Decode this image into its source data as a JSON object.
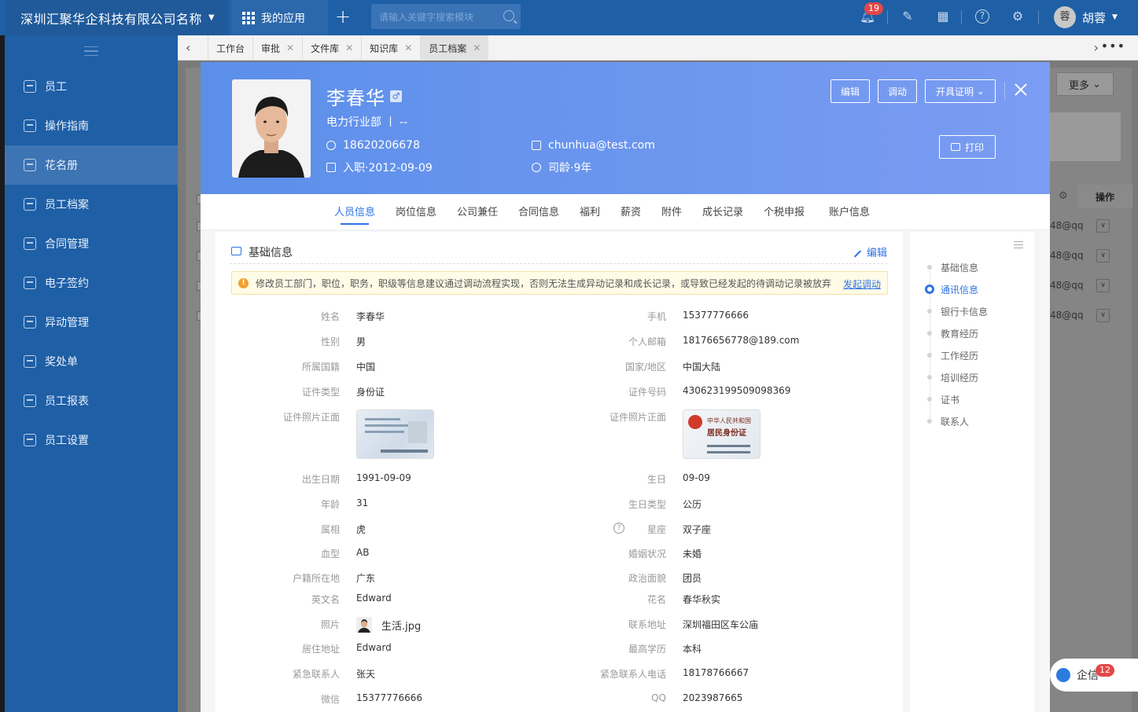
{
  "topbar": {
    "company": "深圳汇聚华企科技有限公司名称",
    "my_apps": "我的应用",
    "search_placeholder": "请输入关键字搜索模块",
    "notif_count": "19",
    "user_avatar": "蓉",
    "user_name": "胡蓉"
  },
  "sidebar": {
    "items": [
      {
        "label": "员工"
      },
      {
        "label": "操作指南"
      },
      {
        "label": "花名册"
      },
      {
        "label": "员工档案"
      },
      {
        "label": "合同管理"
      },
      {
        "label": "电子签约"
      },
      {
        "label": "异动管理"
      },
      {
        "label": "奖处单"
      },
      {
        "label": "员工报表"
      },
      {
        "label": "员工设置"
      }
    ],
    "active_index": 2
  },
  "tabs": [
    {
      "label": "工作台",
      "closable": false
    },
    {
      "label": "审批",
      "closable": true
    },
    {
      "label": "文件库",
      "closable": true
    },
    {
      "label": "知识库",
      "closable": true
    },
    {
      "label": "员工档案",
      "closable": true,
      "active": true
    }
  ],
  "background": {
    "more_label": "更多",
    "op_header": "操作",
    "email_fragment": "48@qq"
  },
  "qixin": {
    "label": "企信",
    "count": "12"
  },
  "profile": {
    "name": "李春华",
    "gender_symbol": "♂",
    "dept": "电力行业部 丨 --",
    "phone": "18620206678",
    "email": "chunhua@test.com",
    "join": "入职·2012-09-09",
    "seniority": "司龄·9年",
    "btn_edit": "编辑",
    "btn_transfer": "调动",
    "btn_cert": "开具证明",
    "btn_print": "打印"
  },
  "mtabs": [
    {
      "label": "人员信息",
      "active": true
    },
    {
      "label": "岗位信息"
    },
    {
      "label": "公司兼任"
    },
    {
      "label": "合同信息"
    },
    {
      "label": "福利"
    },
    {
      "label": "薪资"
    },
    {
      "label": "附件"
    },
    {
      "label": "成长记录"
    },
    {
      "label": "个税申报"
    },
    {
      "label": "账户信息"
    }
  ],
  "basic": {
    "title": "基础信息",
    "edit": "编辑",
    "warning": "修改员工部门，职位，职务，职级等信息建议通过调动流程实现，否则无法生成异动记录和成长记录，或导致已经发起的待调动记录被放弃",
    "warning_link": "发起调动"
  },
  "fields": {
    "name_l": "姓名",
    "name_v": "李春华",
    "mobile_l": "手机",
    "mobile_v": "15377776666",
    "sex_l": "性别",
    "sex_v": "男",
    "pemail_l": "个人邮箱",
    "pemail_v": "18176656778@189.com",
    "nat_l": "所属国籍",
    "nat_v": "中国",
    "region_l": "国家/地区",
    "region_v": "中国大陆",
    "idtype_l": "证件类型",
    "idtype_v": "身份证",
    "idno_l": "证件号码",
    "idno_v": "430623199509098369",
    "idfront_l": "证件照片正面",
    "idback_l": "证件照片正面",
    "idcard_back_title": "中华人民共和国",
    "idcard_back_title2": "居民身份证",
    "birth_l": "出生日期",
    "birth_v": "1991-09-09",
    "bday_l": "生日",
    "bday_v": "09-09",
    "age_l": "年龄",
    "age_v": "31",
    "bdtype_l": "生日类型",
    "bdtype_v": "公历",
    "zodiac_l": "属相",
    "zodiac_v": "虎",
    "star_l": "星座",
    "star_v": "双子座",
    "blood_l": "血型",
    "blood_v": "AB",
    "marital_l": "婚姻状况",
    "marital_v": "未婚",
    "huji_l": "户籍所在地",
    "huji_v": "广东",
    "political_l": "政治面貌",
    "political_v": "团员",
    "en_l": "英文名",
    "en_v": "Edward",
    "nick_l": "花名",
    "nick_v": "春华秋实",
    "photo_l": "照片",
    "photo_v": "生活.jpg",
    "addr_l": "联系地址",
    "addr_v": "深圳福田区车公庙",
    "live_l": "居住地址",
    "live_v": "Edward",
    "edu_l": "最高学历",
    "edu_v": "本科",
    "em_l": "紧急联系人",
    "em_v": "张天",
    "emtel_l": "紧急联系人电话",
    "emtel_v": "18178766667",
    "wx_l": "微信",
    "wx_v": "15377776666",
    "qq_l": "QQ",
    "qq_v": "2023987665"
  },
  "anchors": [
    {
      "label": "基础信息"
    },
    {
      "label": "通讯信息",
      "active": true
    },
    {
      "label": "银行卡信息"
    },
    {
      "label": "教育经历"
    },
    {
      "label": "工作经历"
    },
    {
      "label": "培训经历"
    },
    {
      "label": "证书"
    },
    {
      "label": "联系人"
    }
  ]
}
